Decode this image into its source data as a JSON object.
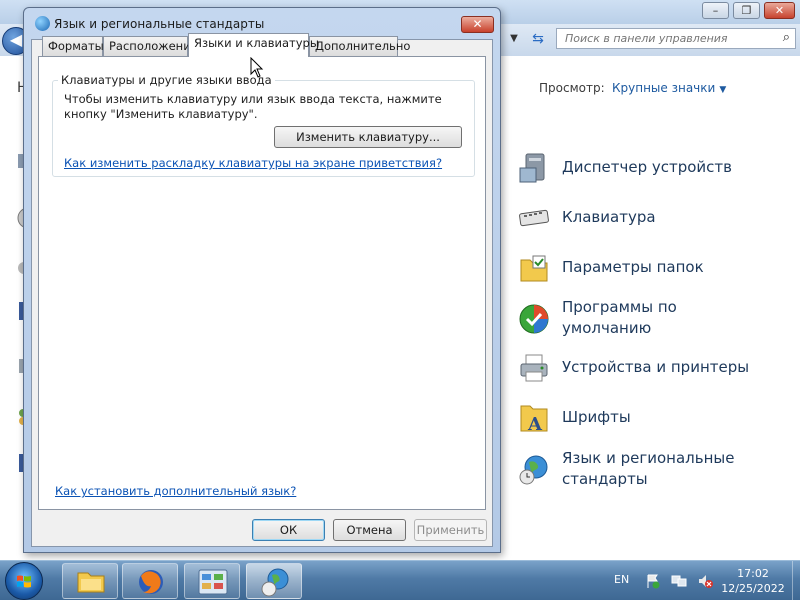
{
  "control_panel": {
    "search_placeholder": "Поиск в панели управления",
    "view_label": "Просмотр:",
    "view_value": "Крупные значки",
    "items": [
      {
        "label": "Диспетчер устройств",
        "icon": "device-manager-icon"
      },
      {
        "label": "Клавиатура",
        "icon": "keyboard-icon"
      },
      {
        "label": "Параметры папок",
        "icon": "folder-options-icon"
      },
      {
        "label": "Программы по умолчанию",
        "icon": "default-programs-icon"
      },
      {
        "label": "Устройства и принтеры",
        "icon": "printer-icon"
      },
      {
        "label": "Шрифты",
        "icon": "fonts-icon"
      },
      {
        "label": "Язык и региональные стандарты",
        "icon": "globe-icon"
      }
    ],
    "left_partial_letter": "Н"
  },
  "dialog": {
    "title": "Язык и региональные стандарты",
    "close_glyph": "✕",
    "tabs": [
      "Форматы",
      "Расположение",
      "Языки и клавиатуры",
      "Дополнительно"
    ],
    "active_tab": 2,
    "group_title": "Клавиатуры и другие языки ввода",
    "group_text": "Чтобы изменить клавиатуру или язык ввода текста, нажмите кнопку \"Изменить клавиатуру\".",
    "change_keyboard_button": "Изменить клавиатуру...",
    "welcome_screen_link": "Как изменить раскладку клавиатуры на экране приветствия?",
    "install_language_link": "Как установить дополнительный язык?",
    "ok_button": "ОК",
    "cancel_button": "Отмена",
    "apply_button": "Применить"
  },
  "taskbar": {
    "language": "EN",
    "time": "17:02",
    "date": "12/25/2022"
  },
  "colors": {
    "link": "#0a52b4",
    "item_text": "#1e395b",
    "taskbar": "#4f7aa6"
  }
}
